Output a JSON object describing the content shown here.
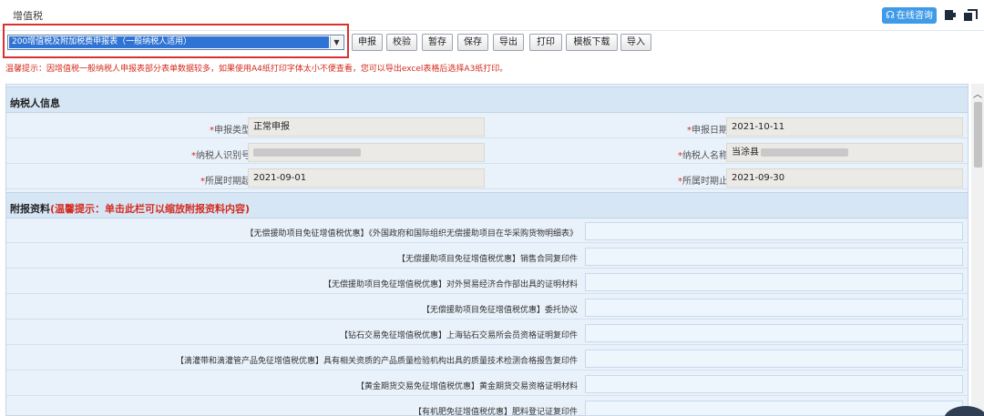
{
  "window": {
    "title": "增值税",
    "consult_label": "在线咨询"
  },
  "toolbar": {
    "report_select_value": "200增值税及附加税费申报表（一般纳税人适用）",
    "buttons": {
      "declare": "申报",
      "verify": "校验",
      "save_draft": "暂存",
      "save": "保存",
      "export": "导出",
      "print": "打印",
      "template_download": "模板下载",
      "import": "导入"
    }
  },
  "tip": "温馨提示：因增值税一般纳税人申报表部分表单数据较多，如果使用A4纸打印字体太小不便查看，您可以导出excel表格后选择A3纸打印。",
  "taxpayer_info": {
    "section_title": "纳税人信息",
    "required_mark": "*",
    "fields": {
      "declare_type": {
        "label": "申报类型",
        "value": "正常申报"
      },
      "declare_date": {
        "label": "申报日期",
        "value": "2021-10-11"
      },
      "taxpayer_id": {
        "label": "纳税人识别号",
        "value": ""
      },
      "taxpayer_name": {
        "label": "纳税人名称",
        "value": "当涂县"
      },
      "period_start": {
        "label": "所属时期起",
        "value": "2021-09-01"
      },
      "period_end": {
        "label": "所属时期止",
        "value": "2021-09-30"
      }
    }
  },
  "attachments": {
    "title": "附报资料",
    "note": "(温馨提示：单击此栏可以缩放附报资料内容)",
    "items": [
      "【无偿援助项目免征增值税优惠】《外国政府和国际组织无偿援助项目在华采购货物明细表》",
      "【无偿援助项目免征增值税优惠】销售合同复印件",
      "【无偿援助项目免征增值税优惠】对外贸易经济合作部出具的证明材料",
      "【无偿援助项目免征增值税优惠】委托协议",
      "【钻石交易免征增值税优惠】上海钻石交易所会员资格证明复印件",
      "【滴灌带和滴灌管产品免征增值税优惠】具有相关资质的产品质量检验机构出具的质量技术检测合格报告复印件",
      "【黄金期货交易免征增值税优惠】黄金期货交易资格证明材料",
      "【有机肥免征增值税优惠】肥料登记证复印件"
    ]
  }
}
